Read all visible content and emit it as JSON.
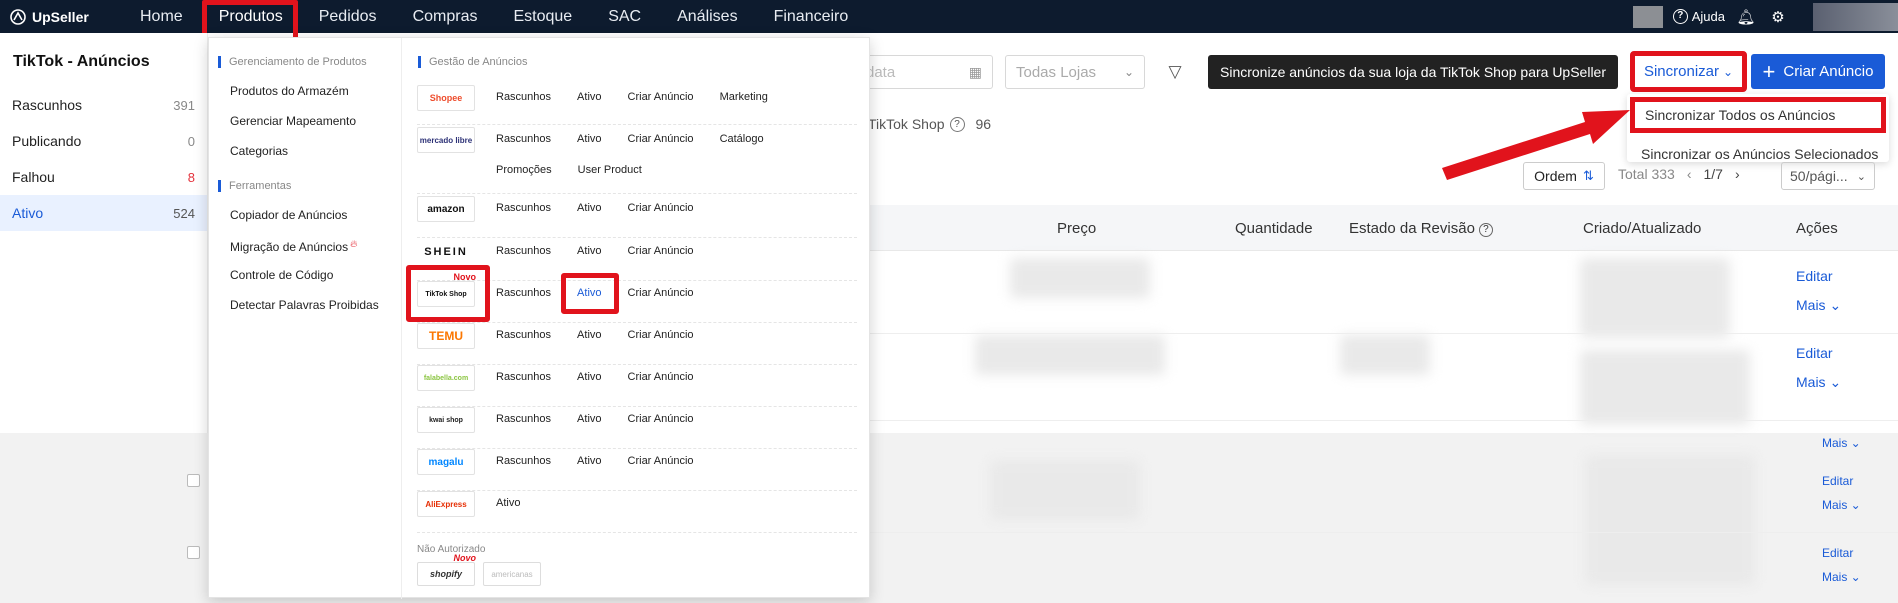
{
  "brand": {
    "name": "UpSeller"
  },
  "nav": {
    "items": [
      "Home",
      "Produtos",
      "Pedidos",
      "Compras",
      "Estoque",
      "SAC",
      "Análises",
      "Financeiro"
    ],
    "help_label": "Ajuda"
  },
  "left_panel": {
    "title": "TikTok - Anúncios",
    "items": [
      {
        "label": "Rascunhos",
        "count": "391"
      },
      {
        "label": "Publicando",
        "count": "0"
      },
      {
        "label": "Falhou",
        "count": "8"
      },
      {
        "label": "Ativo",
        "count": "524"
      }
    ]
  },
  "filters": {
    "date_placeholder": "data",
    "store_select": "Todas Lojas"
  },
  "tooltip": "Sincronize anúncios da sua loja da TikTok Shop para UpSeller",
  "sync": {
    "button_label": "Sincronizar",
    "options": [
      "Sincronizar Todos os Anúncios",
      "Sincronizar os Anúncios Selecionados"
    ]
  },
  "create_button": "Criar Anúncio",
  "store_tab": {
    "label": "TikTok Shop",
    "count": "96"
  },
  "toolbar": {
    "ordem": "Ordem",
    "total": "Total 333",
    "page": "1/7",
    "per_page": "50/pági..."
  },
  "table": {
    "headers": [
      "Preço",
      "Quantidade",
      "Estado da Revisão",
      "Criado/Atualizado",
      "Ações"
    ],
    "actions": {
      "edit": "Editar",
      "more": "Mais"
    }
  },
  "mega_menu": {
    "left_sections": [
      {
        "heading": "Gerenciamento de Produtos",
        "items": [
          "Produtos do Armazém",
          "Gerenciar Mapeamento",
          "Categorias"
        ]
      },
      {
        "heading": "Ferramentas",
        "items": [
          "Copiador de Anúncios",
          "Migração de Anúncios",
          "Controle de Código",
          "Detectar Palavras Proibidas"
        ]
      }
    ],
    "right_heading": "Gestão de Anúncios",
    "platforms": [
      {
        "logo": "Shopee",
        "links": [
          "Rascunhos",
          "Ativo",
          "Criar Anúncio",
          "Marketing"
        ]
      },
      {
        "logo": "mercado libre",
        "links": [
          "Rascunhos",
          "Ativo",
          "Criar Anúncio",
          "Catálogo",
          "Promoções",
          "User Product"
        ]
      },
      {
        "logo": "amazon",
        "links": [
          "Rascunhos",
          "Ativo",
          "Criar Anúncio"
        ]
      },
      {
        "logo": "SHEIN",
        "links": [
          "Rascunhos",
          "Ativo",
          "Criar Anúncio"
        ]
      },
      {
        "logo": "TikTok Shop",
        "links": [
          "Rascunhos",
          "Ativo",
          "Criar Anúncio"
        ],
        "badge": "Novo"
      },
      {
        "logo": "TEMU",
        "links": [
          "Rascunhos",
          "Ativo",
          "Criar Anúncio"
        ]
      },
      {
        "logo": "falabella.com",
        "links": [
          "Rascunhos",
          "Ativo",
          "Criar Anúncio"
        ]
      },
      {
        "logo": "kwai shop",
        "links": [
          "Rascunhos",
          "Ativo",
          "Criar Anúncio"
        ]
      },
      {
        "logo": "magalu",
        "links": [
          "Rascunhos",
          "Ativo",
          "Criar Anúncio"
        ]
      },
      {
        "logo": "AliExpress",
        "links": [
          "Ativo"
        ]
      }
    ],
    "not_authorized": {
      "heading": "Não Autorizado",
      "logos": [
        "shopify",
        "americanas"
      ],
      "badge": "Novo"
    }
  },
  "colors": {
    "nav_bg": "#0d1b2e",
    "primary": "#1a5bd7",
    "highlight": "#e1131c"
  }
}
